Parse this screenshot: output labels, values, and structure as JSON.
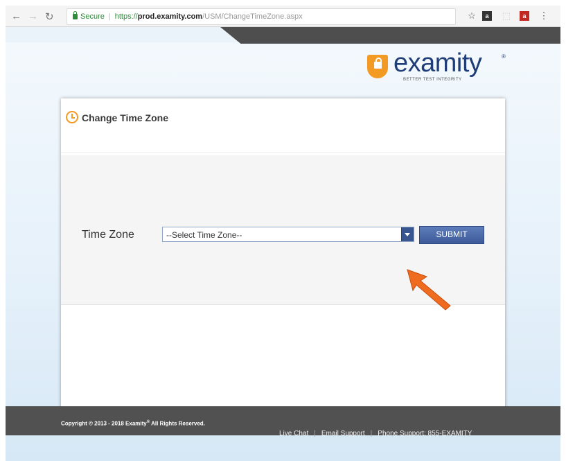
{
  "browser": {
    "secure_label": "Secure",
    "url_scheme": "https://",
    "url_host": "prod.examity.com",
    "url_path": "/USM/ChangeTimeZone.aspx"
  },
  "logo": {
    "name": "examity",
    "registered": "®",
    "tagline": "BETTER TEST INTEGRITY"
  },
  "card": {
    "title": "Change Time Zone"
  },
  "form": {
    "time_zone_label": "Time Zone",
    "time_zone_selected": "--Select Time Zone--",
    "submit_label": "SUBMIT"
  },
  "footer": {
    "copyright": "Copyright © 2013 - 2018 Examity",
    "registered": "®",
    "rights": "All Rights Reserved.",
    "links": [
      "Live Chat",
      "Email Support",
      "Phone Support: 855-EXAMITY"
    ]
  },
  "colors": {
    "brand_orange": "#f39a24",
    "brand_navy": "#1f3e78",
    "button_blue": "#4a68a8",
    "footer_gray": "#515151"
  }
}
